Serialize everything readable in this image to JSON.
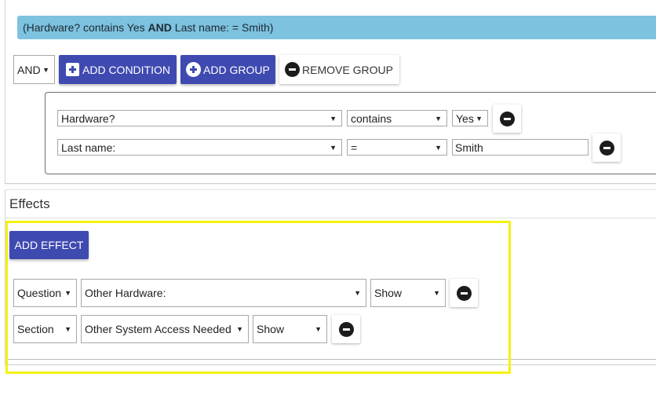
{
  "conditions": {
    "summary": {
      "prefix": "(Hardware? contains Yes ",
      "operator": "AND",
      "suffix": " Last name: = Smith)"
    },
    "logic_select": "AND",
    "add_condition_label": "ADD CONDITION",
    "add_group_label": "ADD GROUP",
    "remove_group_label": "REMOVE GROUP",
    "rows": [
      {
        "field": "Hardware?",
        "operator": "contains",
        "value": "Yes"
      },
      {
        "field": "Last name:",
        "operator": "=",
        "value": "Smith"
      }
    ]
  },
  "effects": {
    "title": "Effects",
    "add_effect_label": "ADD EFFECT",
    "rows": [
      {
        "type": "Question",
        "target": "Other Hardware:",
        "action": "Show"
      },
      {
        "type": "Section",
        "target": "Other System Access Needed",
        "action": "Show"
      }
    ]
  },
  "icons": {
    "dropdown": "caret-down-icon",
    "add": "plus-icon",
    "remove": "minus-circle-icon"
  },
  "colors": {
    "accent": "#3f4ab1",
    "summary_bg": "#7dc2df",
    "highlight": "#f5f20e"
  }
}
